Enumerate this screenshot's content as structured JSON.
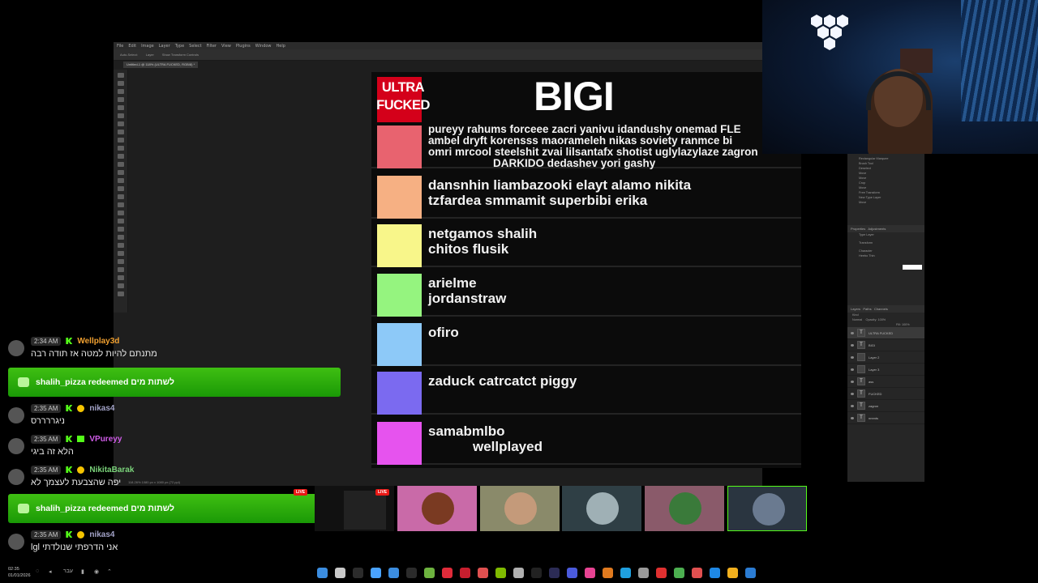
{
  "photoshop": {
    "menu": [
      "File",
      "Edit",
      "Image",
      "Layer",
      "Type",
      "Select",
      "Filter",
      "View",
      "Plugins",
      "Window",
      "Help"
    ],
    "options": [
      "Auto-Select:",
      "Layer",
      "Show Transform Controls"
    ],
    "doc_tab": "Untitled-1 @ 118% (ULTRA FUCKED, RGB/8) *",
    "status": "118.26%   1080 px x 1080 px (72 ppi)",
    "history": [
      "Rectangular Marquee",
      "Brush Tool",
      "Deselect",
      "Move",
      "Move",
      "Crop",
      "Move",
      "Free Transform",
      "New Type Layer",
      "Move"
    ],
    "panels": {
      "properties": "Properties",
      "adjustments": "Adjustments",
      "type_layer": "Type Layer",
      "transform": "Transform",
      "character": "Character",
      "font": "Heebo Thin",
      "layers": "Layers",
      "paths": "Paths",
      "channels": "Channels",
      "kind": "Kind",
      "mode": "Normal",
      "opacity": "Opacity: 100%",
      "fill": "Fill: 100%"
    },
    "layers": [
      "ULTRA FUCKED",
      "BIGI",
      "Layer 2",
      "Layer 3",
      "ass",
      "FUCKED",
      "zagron",
      "nmmts"
    ]
  },
  "tierlist": {
    "title": "BIGI",
    "header_label_line1": "ULTRA",
    "header_label_line2": "FUCKED",
    "rows": [
      {
        "color": "#e8636f",
        "lines": [
          "pureyy rahums forceee zacri yanivu idandushy onemad FLE",
          "ambel dryft korensss maorameleh nikas soviety ranmce bi",
          "omri mrcool steelshit zvai lilsantafx shotist uglylazylaze zagron",
          "DARKIDO dedashev yori gashy"
        ]
      },
      {
        "color": "#f6b083",
        "lines": [
          "dansnhin liambazooki elayt alamo nikita",
          "tzfardea smmamit superbibi erika"
        ]
      },
      {
        "color": "#f8f68a",
        "lines": [
          "netgamos shalih",
          "chitos flusik"
        ]
      },
      {
        "color": "#95f47f",
        "lines": [
          "arielme",
          "jordanstraw"
        ]
      },
      {
        "color": "#8dc9f8",
        "lines": [
          "ofiro"
        ]
      },
      {
        "color": "#7b6af0",
        "lines": [
          "zaduck catrcatct piggy"
        ]
      },
      {
        "color": "#e653ee",
        "lines": [
          "samabmlbo",
          "wellplayed"
        ]
      }
    ]
  },
  "chat": {
    "messages": [
      {
        "time": "2:34 AM",
        "user": "Wellplay3d",
        "user_color": "#f0a030",
        "badge": "k",
        "text": "מתנתם להיות למטה אז תודה רבה"
      },
      {
        "time": "2:35 AM",
        "user": "nikas4",
        "user_color": "#a3a3c8",
        "badge": "coin",
        "text": "ניגררררס"
      },
      {
        "time": "2:35 AM",
        "user": "VPureyy",
        "user_color": "#d05ce8",
        "badge": "sub",
        "text": "הלא זה ביגי"
      },
      {
        "time": "2:35 AM",
        "user": "NikitaBarak",
        "user_color": "#7bd47b",
        "badge": "coin",
        "text": "יפה שהצבעת לעצמך לא"
      },
      {
        "time": "2:35 AM",
        "user": "nikas4",
        "user_color": "#a3a3c8",
        "badge": "coin",
        "text": "lgl אני הדרפתי שנולדתי"
      }
    ],
    "redemptions": [
      {
        "text": "shalih_pizza redeemed לשתות מים"
      },
      {
        "text": "shalih_pizza redeemed לשתות מים"
      }
    ]
  },
  "viewer_tiles": [
    {
      "bg": "#c96aa8",
      "face": "#7a3a22"
    },
    {
      "bg": "#8a8a6a",
      "face": "#c49a7a"
    },
    {
      "bg": "#2f3f45",
      "face": "#9fb0b5"
    },
    {
      "bg": "#8a5a6a",
      "face": "#3a7a3a"
    },
    {
      "bg": "#2a3540",
      "face": "#6a7a90"
    }
  ],
  "live_label": "LIVE",
  "taskbar": {
    "time": "02:35",
    "date": "01/01/2026",
    "lang": "עבר"
  },
  "colors": {
    "header_red": "#d4001a",
    "redeem_green": "#2fb00c"
  }
}
